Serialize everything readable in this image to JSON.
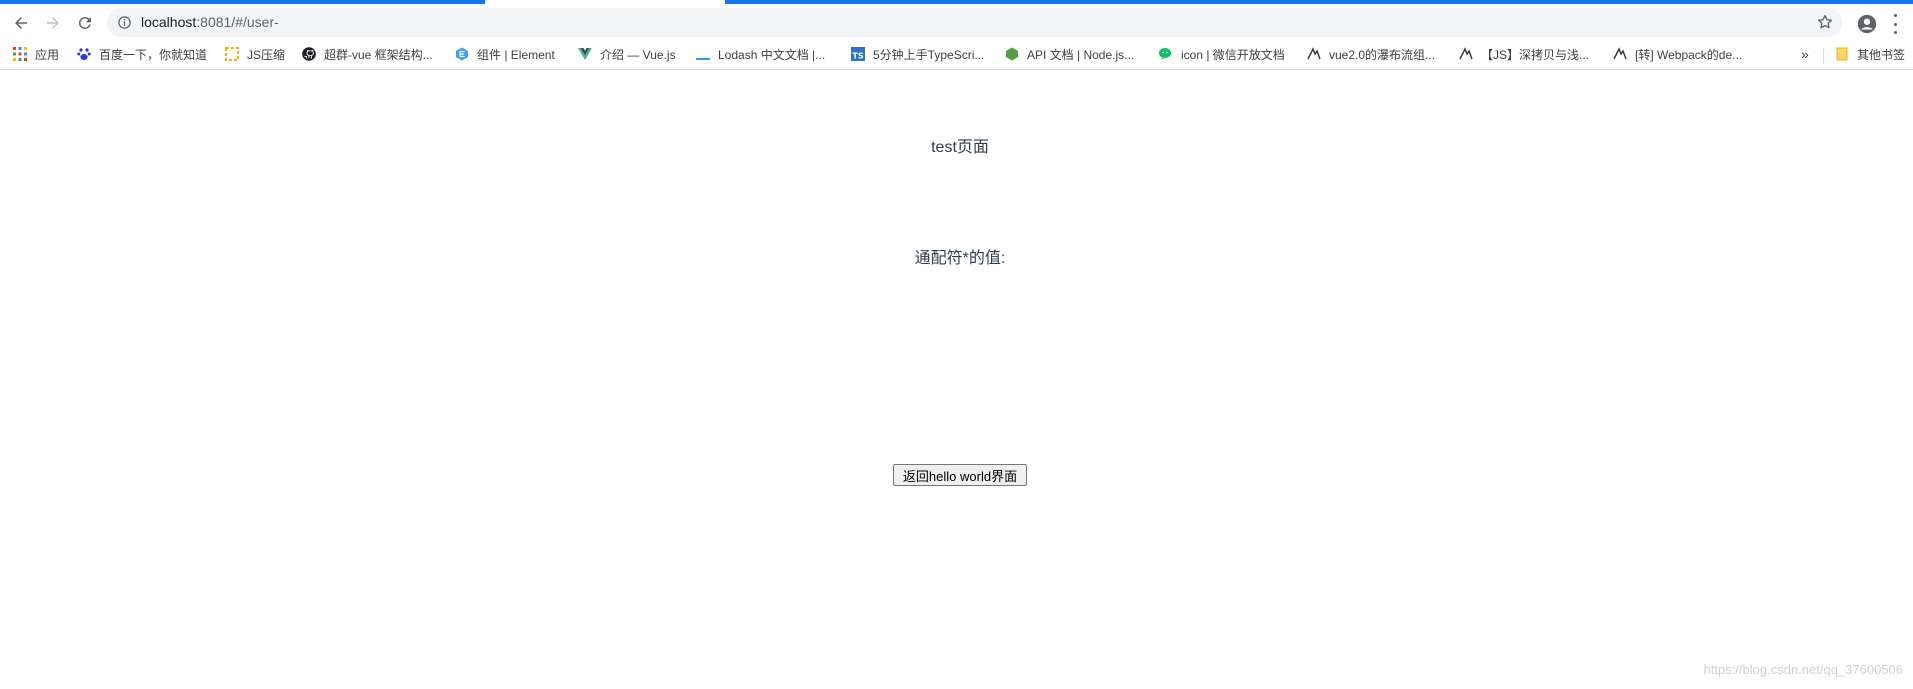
{
  "browser": {
    "url_host": "localhost",
    "url_rest": ":8081/#/user-"
  },
  "bookmarks": {
    "items": [
      {
        "label": "应用",
        "icon": "apps-grid-icon"
      },
      {
        "label": "百度一下，你就知道",
        "icon": "baidu-paw-icon"
      },
      {
        "label": "JS压缩",
        "icon": "js-compress-icon"
      },
      {
        "label": "超群-vue 框架结构...",
        "icon": "github-icon"
      },
      {
        "label": "组件 | Element",
        "icon": "element-icon"
      },
      {
        "label": "介绍 — Vue.js",
        "icon": "vue-icon"
      },
      {
        "label": "Lodash 中文文档 |...",
        "icon": "lodash-icon"
      },
      {
        "label": "5分钟上手TypeScri...",
        "icon": "typescript-icon"
      },
      {
        "label": "API 文档 | Node.js...",
        "icon": "nodejs-icon"
      },
      {
        "label": "icon | 微信开放文档",
        "icon": "wechat-icon"
      },
      {
        "label": "vue2.0的瀑布流组...",
        "icon": "site-icon"
      },
      {
        "label": "【JS】深拷贝与浅...",
        "icon": "site-icon"
      },
      {
        "label": "[转] Webpack的de...",
        "icon": "site-icon"
      }
    ],
    "more": "»",
    "other_folder": "其他书签"
  },
  "page": {
    "title": "test页面",
    "wildcard_label": "通配符*的值:",
    "back_button": "返回hello world界面"
  },
  "watermark": "https://blog.csdn.net/qq_37600506"
}
